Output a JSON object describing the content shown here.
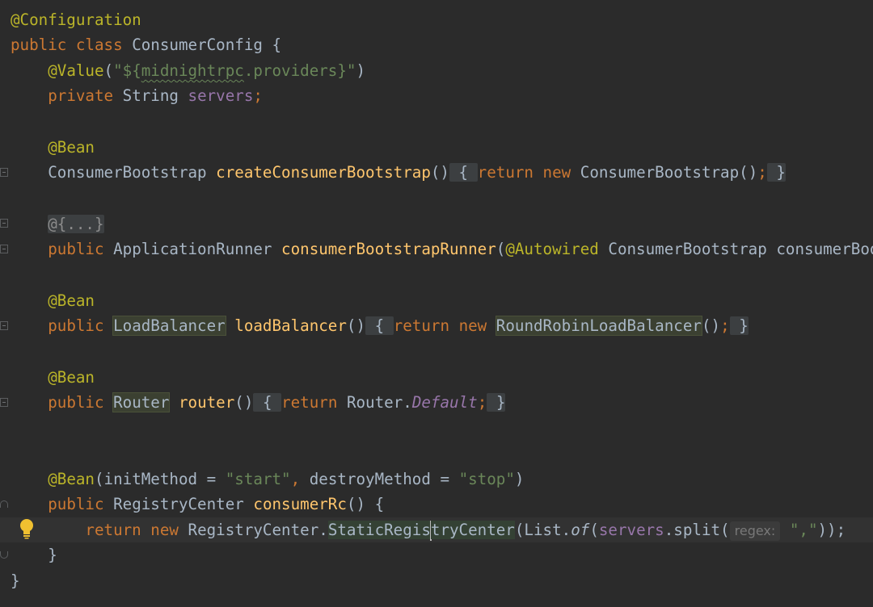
{
  "code": {
    "l1": {
      "ann": "@Configuration"
    },
    "l2": {
      "kw1": "public",
      "kw2": "class",
      "name": "ConsumerConfig",
      "brace": "{"
    },
    "l3": {
      "ann": "@Value",
      "open": "(",
      "str1": "\"${",
      "str2": "midnightrpc",
      "str3": ".providers}\"",
      "close": ")"
    },
    "l4": {
      "kw": "private",
      "type": "String",
      "field": "servers",
      "semi": ";"
    },
    "l6": {
      "ann": "@Bean"
    },
    "l7": {
      "type": "ConsumerBootstrap",
      "method": "createConsumerBootstrap",
      "paren": "()",
      "ob": "{",
      "kw1": "return",
      "kw2": "new",
      "ctor": "ConsumerBootstrap",
      "call": "()",
      "semi": ";",
      "cb": "}"
    },
    "l9": {
      "fold": "@{...}"
    },
    "l10": {
      "kw": "public",
      "type": "ApplicationRunner",
      "method": "consumerBootstrapRunner",
      "open": "(",
      "ann": "@Autowired",
      "ptype": "ConsumerBootstrap",
      "pname": "consumerBoo"
    },
    "l12": {
      "ann": "@Bean"
    },
    "l13": {
      "kw": "public",
      "type": "LoadBalancer",
      "method": "loadBalancer",
      "paren": "()",
      "ob": "{",
      "kw1": "return",
      "kw2": "new",
      "ctor": "RoundRobinLoadBalancer",
      "call": "()",
      "semi": ";",
      "cb": "}"
    },
    "l15": {
      "ann": "@Bean"
    },
    "l16": {
      "kw": "public",
      "type": "Router",
      "method": "router",
      "paren": "()",
      "ob": "{",
      "kw1": "return",
      "cls": "Router",
      "dot": ".",
      "field": "Default",
      "semi": ";",
      "cb": "}"
    },
    "l19": {
      "ann": "@Bean",
      "open": "(",
      "a1": "initMethod",
      "eq1": " = ",
      "s1": "\"start\"",
      "comma": ",",
      "a2": "destroyMethod",
      "eq2": " = ",
      "s2": "\"stop\"",
      "close": ")"
    },
    "l20": {
      "kw": "public",
      "type": "RegistryCenter",
      "method": "consumerRc",
      "rest": "() {"
    },
    "l21": {
      "kw1": "return",
      "kw2": "new",
      "cls": "RegistryCenter",
      "dot": ".",
      "inner1": "StaticRegis",
      "inner2": "tryCenter",
      "open": "(",
      "list": "List",
      "dot2": ".",
      "of": "of",
      "open2": "(",
      "fld": "servers",
      "split": ".split(",
      "hint": "regex:",
      "str": "\",\"",
      "close": "));"
    },
    "l22": {
      "brace": "}"
    },
    "l23": {
      "brace": "}"
    }
  },
  "icons": {
    "bulb": "lightbulb-icon",
    "fold": "fold-marker-icon"
  },
  "colors": {
    "background": "#2b2b2b",
    "keyword": "#cc7832",
    "annotation": "#bbb529",
    "string": "#6a8759",
    "method": "#ffc66d",
    "field": "#9876aa",
    "text": "#a9b7c6"
  }
}
